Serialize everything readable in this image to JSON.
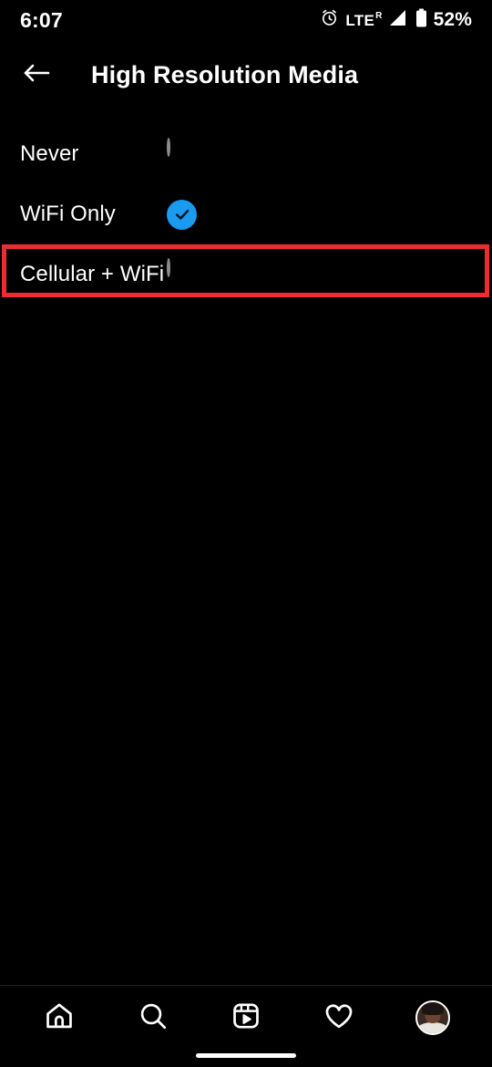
{
  "status_bar": {
    "time": "6:07",
    "alarm_icon": "alarm-clock-icon",
    "network_label": "LTE",
    "network_roaming": "R",
    "signal_icon": "signal-bars-icon",
    "battery_icon": "battery-icon",
    "battery_percent": "52%"
  },
  "header": {
    "back_icon": "back-arrow-icon",
    "title": "High Resolution Media"
  },
  "options": {
    "items": [
      {
        "label": "Never",
        "selected": false,
        "highlighted": false
      },
      {
        "label": "WiFi Only",
        "selected": true,
        "highlighted": false
      },
      {
        "label": "Cellular + WiFi",
        "selected": false,
        "highlighted": true
      }
    ]
  },
  "bottom_nav": {
    "items": [
      {
        "name": "home-icon",
        "label": "Home"
      },
      {
        "name": "search-icon",
        "label": "Search"
      },
      {
        "name": "reels-icon",
        "label": "Reels"
      },
      {
        "name": "heart-icon",
        "label": "Activity"
      },
      {
        "name": "avatar-icon",
        "label": "Profile"
      }
    ]
  },
  "colors": {
    "background": "#000000",
    "text": "#ffffff",
    "accent_selected": "#1a9bf0",
    "highlight_box": "#ef2a33",
    "radio_outline": "#8d8d8d",
    "divider": "#1f1f1f"
  }
}
